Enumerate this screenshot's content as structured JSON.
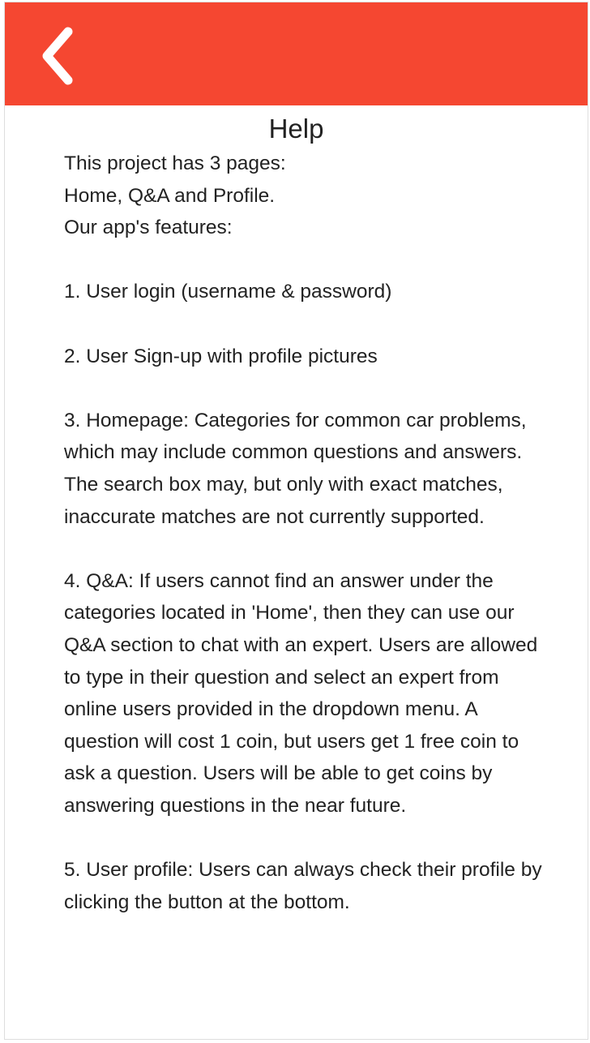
{
  "header": {
    "back_icon": "chevron-left-icon",
    "color": "#f54731"
  },
  "page": {
    "title": "Help"
  },
  "help": {
    "intro": [
      "This project has 3 pages:",
      "Home, Q&A and Profile.",
      "Our app's features:"
    ],
    "features": [
      "1. User login (username & password)",
      "2. User Sign-up with profile pictures",
      "3. Homepage: Categories for common car problems, which may include common questions and answers. The search box may, but only with exact matches, inaccurate matches are not currently supported.",
      "4. Q&A: If users cannot find an answer under the categories located in 'Home', then they can use our Q&A section to chat with an expert. Users are allowed to type in their question and select an expert from online users provided in the dropdown menu. A question will cost 1 coin, but users get 1 free coin to ask a question. Users will be able to get coins by answering questions in the near future.",
      "5. User profile: Users can always check their profile by clicking the button at the bottom."
    ]
  }
}
